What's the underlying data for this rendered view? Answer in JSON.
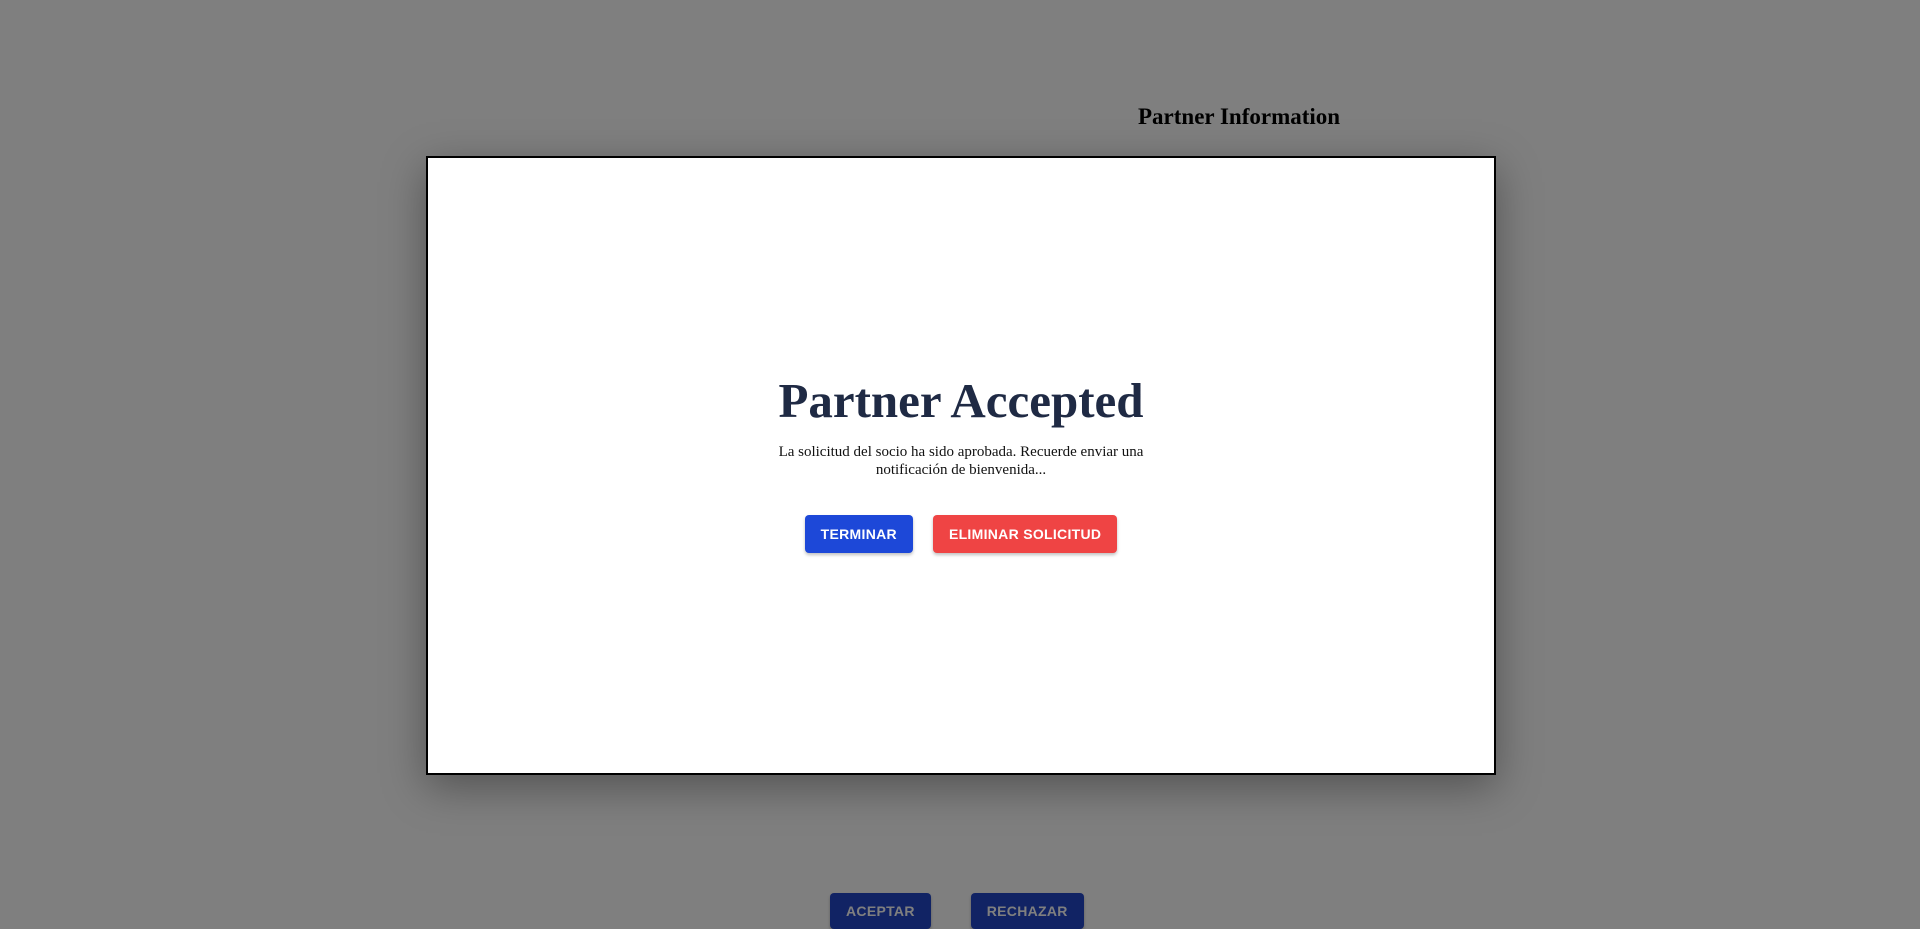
{
  "page": {
    "title": "Partner Information",
    "actions": {
      "accept_label": "ACEPTAR",
      "reject_label": "RECHAZAR"
    }
  },
  "modal": {
    "title": "Partner Accepted",
    "message": "La solicitud del socio ha sido aprobada. Recuerde enviar una notificación de bienvenida...",
    "finish_label": "TERMINAR",
    "delete_label": "ELIMINAR SOLICITUD"
  },
  "colors": {
    "primary": "#1d48d8",
    "danger": "#ef4444",
    "overlay": "rgba(0,0,0,0.5)",
    "title_text": "#1f2a44"
  }
}
